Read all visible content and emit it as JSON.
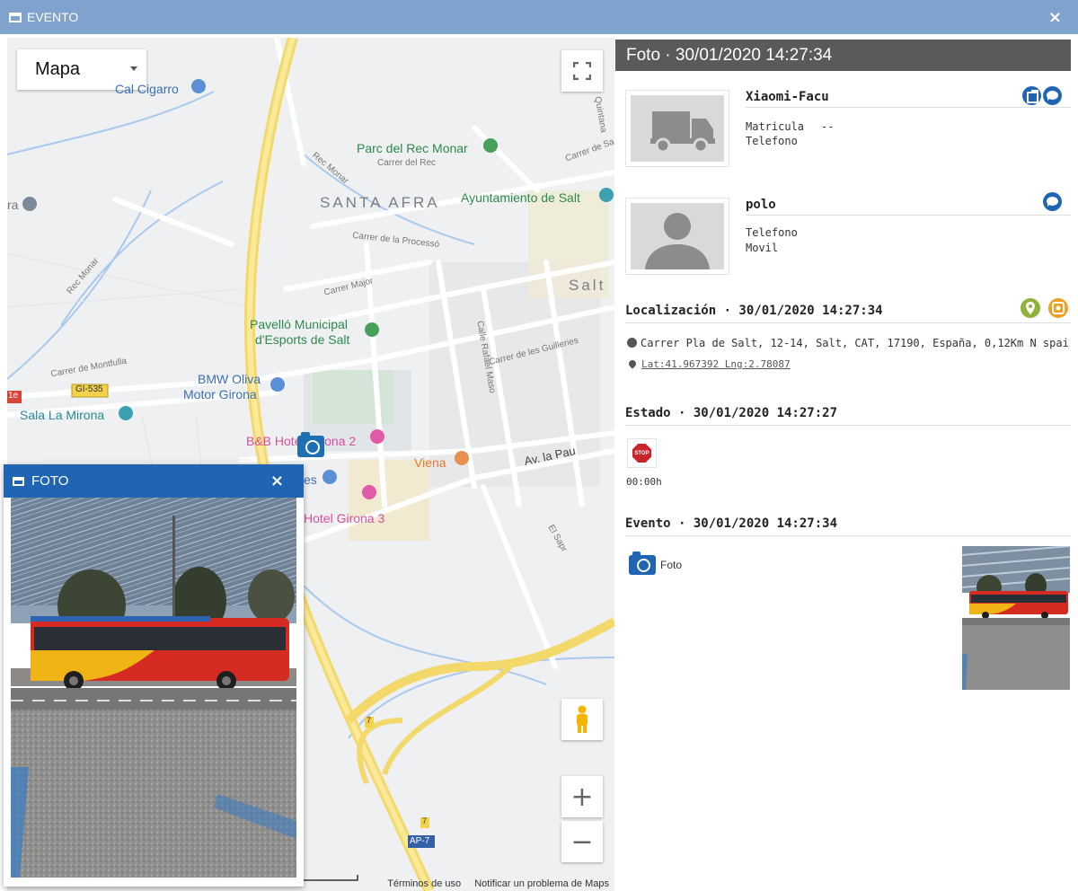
{
  "window": {
    "title": "EVENTO",
    "close_glyph": "×"
  },
  "map": {
    "type_selector": "Mapa",
    "fullscreen_icon": "fullscreen-icon",
    "pegman_icon": "pegman-icon",
    "zoom_in": "+",
    "zoom_out": "−",
    "labels": {
      "cal_cigarro": "Cal Cigarro",
      "parc_rec_monar": "Parc del Rec Monar",
      "santa_afra": "SANTA AFRA",
      "ayuntamiento": "Ayuntamiento de Salt",
      "salt": "Salt",
      "pavello_1": "Pavelló Municipal",
      "pavello_2": "d'Esports de Salt",
      "bmw_1": "BMW Oliva",
      "bmw_2": "Motor Girona",
      "sala_mirona": "Sala La Mirona",
      "bb_hotel": "B&B Hotel Girona 2",
      "viena": "Viena",
      "av_la_pau": "Av. la Pau",
      "hotel_girona3": "Hotel Girona 3",
      "hotel_partial": "es",
      "gi535": "GI-535",
      "ap7": "AP-7",
      "rec_monar": "Rec Monar",
      "rec_monar2": "Rec Monar",
      "carrer_montfulla": "Carrer de Montfulla",
      "carrer_major": "Carrer Major",
      "carrer_processo": "Carrer de la Processó",
      "carrer_rec": "Carrer del Rec",
      "carrer_guilleries": "Carrer de les Guilleries",
      "calle_rafael": "Calle Rafael Maso",
      "el_sapr": "El Sapr",
      "carrer_sa": "Carrer de Sa",
      "quintana": "Quintana",
      "a_partial": "ra",
      "road_7a": "7",
      "road_7b": "7",
      "road_1e": "1e"
    },
    "footer": {
      "terms": "Términos de uso",
      "report": "Notificar un problema de Maps"
    }
  },
  "foto_popup": {
    "title": "FOTO",
    "close_glyph": "×"
  },
  "panel": {
    "header": "Foto · 30/01/2020 14:27:34",
    "vehicle": {
      "name": "Xiaomi-Facu",
      "matricula_label": "Matricula",
      "matricula_value": "--",
      "telefono_label": "Telefono"
    },
    "driver": {
      "name": "polo",
      "telefono_label": "Telefono",
      "movil_label": "Movil"
    },
    "localizacion": {
      "title": "Localización · 30/01/2020 14:27:34",
      "address": "Carrer Pla de Salt, 12-14, Salt, CAT, 17190, España, 0,12Km N spai",
      "coords": "Lat:41.967392 Lng:2.78087"
    },
    "estado": {
      "title": "Estado · 30/01/2020 14:27:27",
      "stop_text": "STOP",
      "duration": "00:00h"
    },
    "evento": {
      "title": "Evento · 30/01/2020 14:27:34",
      "label": "Foto"
    },
    "colors": {
      "accent": "#1f65b4",
      "header_bg": "#595a5c",
      "titlebar": "#7fa3cc",
      "loc_green": "#8db33a",
      "loc_orange": "#f0a020"
    }
  }
}
